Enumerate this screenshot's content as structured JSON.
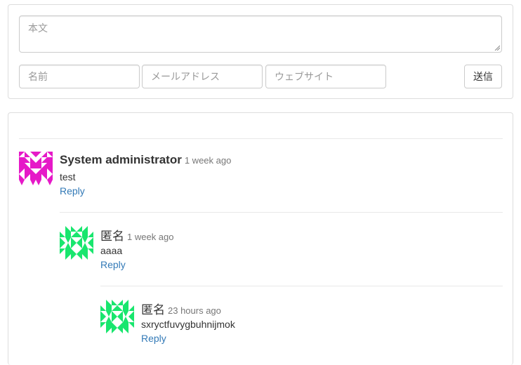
{
  "form": {
    "body_placeholder": "本文",
    "name_placeholder": "名前",
    "email_placeholder": "メールアドレス",
    "website_placeholder": "ウェブサイト",
    "submit_label": "送信"
  },
  "comments": [
    {
      "author": "System administrator",
      "time": "1 week ago",
      "text": "test",
      "reply_label": "Reply",
      "avatar_color": "#e619c8",
      "avatar_icon": "identicon"
    },
    {
      "author": "匿名",
      "time": "1 week ago",
      "text": "aaaa",
      "reply_label": "Reply",
      "avatar_color": "#19e66e",
      "avatar_icon": "identicon"
    },
    {
      "author": "匿名",
      "time": "23 hours ago",
      "text": "sxryctfuvygbuhnijmok",
      "reply_label": "Reply",
      "avatar_color": "#19e66e",
      "avatar_icon": "identicon"
    }
  ],
  "colors": {
    "link": "#337ab7",
    "muted": "#777777",
    "border": "#dddddd"
  }
}
